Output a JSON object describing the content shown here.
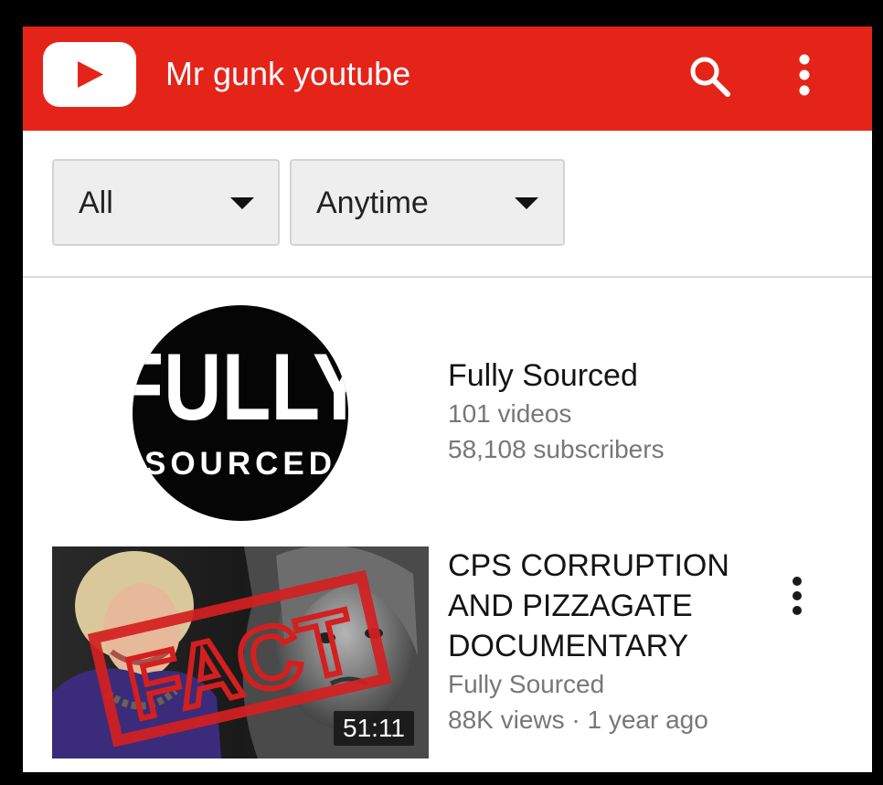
{
  "header": {
    "title": "Mr gunk youtube",
    "logo_icon": "youtube-play-logo",
    "search_icon": "search-icon",
    "menu_icon": "more-vert-icon",
    "bg_color": "#e52419"
  },
  "filters": {
    "type": {
      "selected": "All"
    },
    "date": {
      "selected": "Anytime"
    }
  },
  "channel": {
    "name": "Fully Sourced",
    "videos": "101 videos",
    "subscribers": "58,108 subscribers",
    "avatar_text_top": "FULLY",
    "avatar_text_bottom": "SOURCED"
  },
  "video": {
    "title_lines": [
      "CPS CORRUPTION",
      "AND PIZZAGATE",
      "DOCUMENTARY"
    ],
    "channel": "Fully Sourced",
    "meta": "88K views · 1 year ago",
    "duration": "51:11",
    "stamp_text": "FACT"
  }
}
